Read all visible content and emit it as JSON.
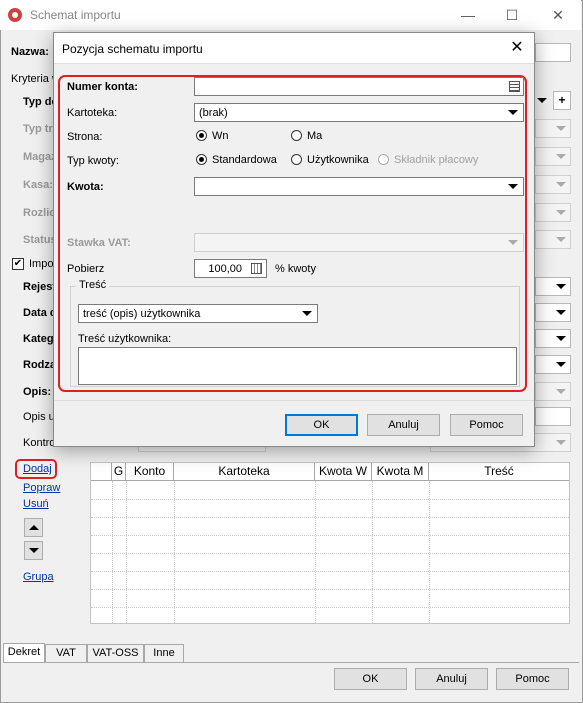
{
  "window": {
    "title": "Schemat importu",
    "minimize": "—",
    "maximize": "☐",
    "close": "✕"
  },
  "background_form": {
    "labels": {
      "nazwa": "Nazwa:",
      "kryteria": "Kryteria w",
      "typ_do": "Typ do",
      "typ_tr": "Typ tr.",
      "magaz": "Magaz",
      "kasa": "Kasa:",
      "rozlicz": "Rozlicz",
      "status": "Status",
      "impo": "Impo",
      "rejest": "Rejest",
      "data_d": "Data d",
      "kateg": "Kateg",
      "rodza": "Rodza",
      "opis": "Opis:",
      "opis_u": "Opis u",
      "kontro": "Kontro"
    },
    "plus": "+"
  },
  "grid_actions": {
    "dodaj": "Dodaj",
    "popraw": "Popraw",
    "usun": "Usuń",
    "grupa": "Grupa"
  },
  "grid": {
    "columns": [
      "G",
      "Konto",
      "Kartoteka",
      "Kwota W",
      "Kwota M",
      "Treść"
    ]
  },
  "tabs": [
    "Dekret",
    "VAT",
    "VAT-OSS",
    "Inne"
  ],
  "footer_buttons": {
    "ok": "OK",
    "cancel": "Anuluj",
    "help": "Pomoc"
  },
  "dialog": {
    "title": "Pozycja schematu importu",
    "close": "✕",
    "numer_konta_label": "Numer konta:",
    "numer_konta_value": "",
    "kartoteka_label": "Kartoteka:",
    "kartoteka_value": "(brak)",
    "strona_label": "Strona:",
    "strona_options": [
      "Wn",
      "Ma"
    ],
    "strona_selected": "Wn",
    "typ_kwoty_label": "Typ kwoty:",
    "typ_kwoty_options": [
      "Standardowa",
      "Użytkownika",
      "Składnik płacowy"
    ],
    "typ_kwoty_selected": "Standardowa",
    "kwota_label": "Kwota:",
    "kwota_value": "",
    "stawka_vat_label": "Stawka VAT:",
    "pobierz_label": "Pobierz",
    "pobierz_value": "100,00",
    "pobierz_unit": "% kwoty",
    "tresc_group": "Treść",
    "tresc_value": "treść (opis) użytkownika",
    "tresc_uzytkownika_label": "Treść użytkownika:",
    "tresc_uzytkownika_value": "",
    "buttons": {
      "ok": "OK",
      "cancel": "Anuluj",
      "help": "Pomoc"
    }
  },
  "colors": {
    "highlight": "#e02020",
    "focus": "#0078d7"
  }
}
